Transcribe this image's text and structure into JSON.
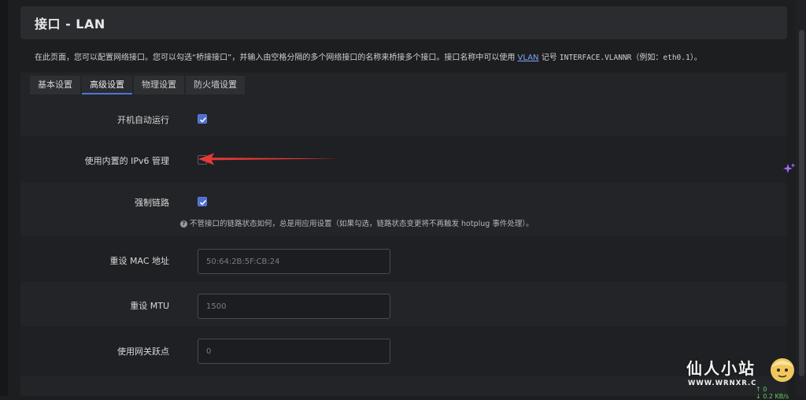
{
  "header": {
    "title": "接口 - LAN"
  },
  "description": {
    "part1": "在此页面，您可以配置网络接口。您可以勾选“桥接接口”，并输入由空格分隔的多个网络接口的名称来桥接多个接口。接口名称中可以使用 ",
    "link": "VLAN",
    "part2": " 记号 ",
    "code": "INTERFACE.VLANNR",
    "part3": "（例如：",
    "example": "eth0.1",
    "part4": "）。"
  },
  "tabs": [
    {
      "label": "基本设置",
      "active": false
    },
    {
      "label": "高级设置",
      "active": true
    },
    {
      "label": "物理设置",
      "active": false
    },
    {
      "label": "防火墙设置",
      "active": false
    }
  ],
  "fields": {
    "auto_start": {
      "label": "开机自动运行",
      "checked": true
    },
    "builtin_ipv6": {
      "label": "使用内置的 IPv6 管理",
      "checked": false
    },
    "force_link": {
      "label": "强制链路",
      "checked": true,
      "hint": "不管接口的链路状态如何，总是用应用设置（如果勾选，链路状态变更将不再触发 hotplug 事件处理）。"
    },
    "mac": {
      "label": "重设 MAC 地址",
      "placeholder": "50:64:2B:5F:CB:24"
    },
    "mtu": {
      "label": "重设 MTU",
      "placeholder": "1500"
    },
    "metric": {
      "label": "使用网关跃点",
      "placeholder": "0"
    }
  },
  "watermark": {
    "title": "仙人小站",
    "url": "WWW.WRNXR.C",
    "speed_up": "↑ 0",
    "speed_down": "↓ 0.2 KB/s"
  },
  "colors": {
    "accent": "#4c6fd0",
    "arrow": "#e53935",
    "sparkle": "#a66cff"
  }
}
